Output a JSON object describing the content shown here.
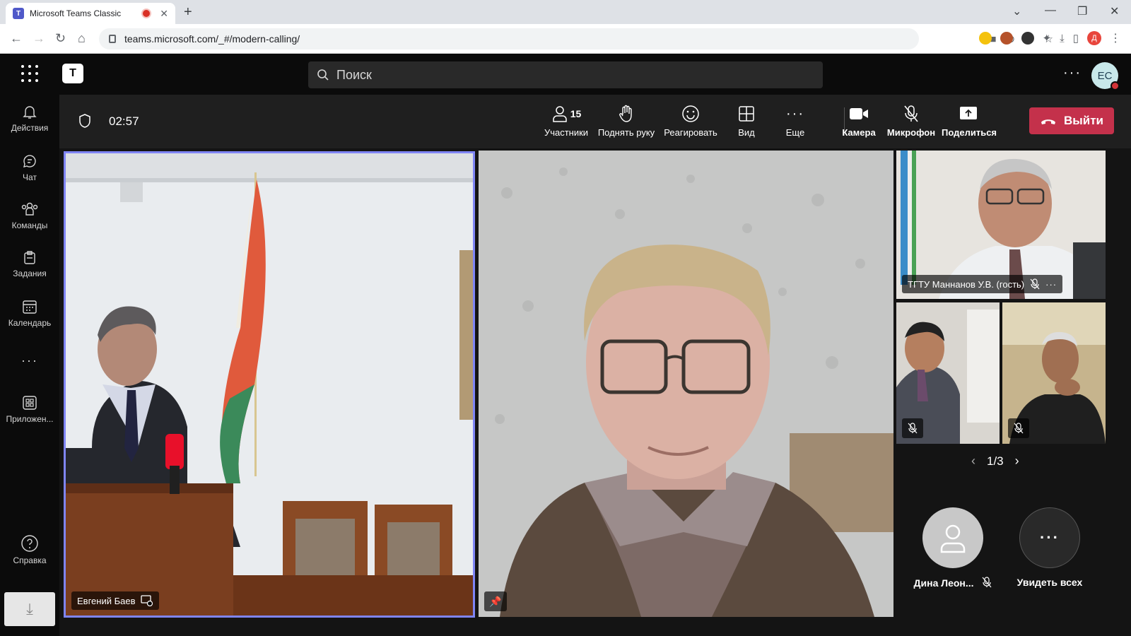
{
  "browser": {
    "tab_title": "Microsoft Teams Classic",
    "url": "teams.microsoft.com/_#/modern-calling/",
    "profile_initial": "Д"
  },
  "teams": {
    "search_placeholder": "Поиск",
    "avatar_initials": "ЕС",
    "more": "···"
  },
  "rail": [
    {
      "label": "Действия",
      "icon": "bell-icon"
    },
    {
      "label": "Чат",
      "icon": "chat-icon"
    },
    {
      "label": "Команды",
      "icon": "teams-icon"
    },
    {
      "label": "Задания",
      "icon": "assignments-icon"
    },
    {
      "label": "Календарь",
      "icon": "calendar-icon"
    },
    {
      "label": "···",
      "icon": "more-icon"
    },
    {
      "label": "Приложен...",
      "icon": "apps-icon"
    },
    {
      "label": "Справка",
      "icon": "help-icon"
    }
  ],
  "meeting": {
    "timer": "02:57",
    "participants_count": "15",
    "participants_label": "Участники",
    "raise_hand_label": "Поднять руку",
    "react_label": "Реагировать",
    "view_label": "Вид",
    "more_label": "Еще",
    "camera_label": "Камера",
    "mic_label": "Микрофон",
    "share_label": "Поделиться",
    "leave_label": "Выйти"
  },
  "tiles": {
    "speaker_name": "Евгений Баев",
    "guest_name": "ТГТУ Маннанов У.В. (гость)"
  },
  "pager": {
    "text": "1/3"
  },
  "roster": {
    "person_name": "Дина Леон...",
    "see_all": "Увидеть всех"
  }
}
